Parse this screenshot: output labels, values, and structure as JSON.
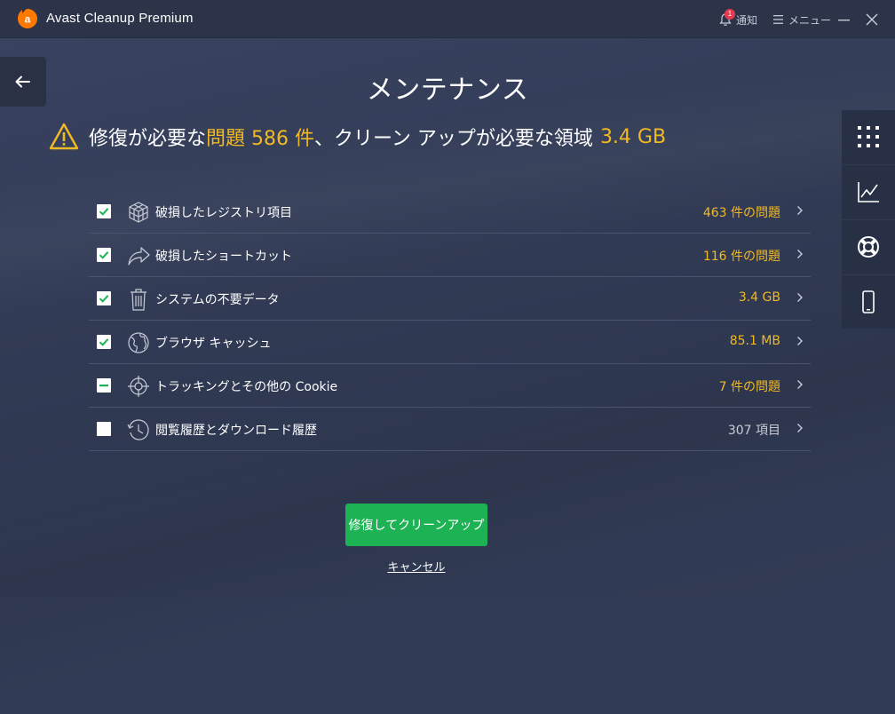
{
  "window": {
    "app_title": "Avast Cleanup Premium",
    "notifications_label": "通知",
    "notifications_count": "1",
    "menu_label": "メニュー"
  },
  "page": {
    "title": "メンテナンス",
    "summary_prefix": "修復が必要な",
    "summary_problems_word": "問題",
    "summary_problems_count": "586 件",
    "summary_middle": "、クリーン アップが必要な領域",
    "summary_space": "3.4 GB"
  },
  "items": [
    {
      "label": "破損したレジストリ項目",
      "value": "463 件の問題",
      "state": "checked",
      "icon": "registry-cube-icon",
      "highlight": true
    },
    {
      "label": "破損したショートカット",
      "value": "116 件の問題",
      "state": "checked",
      "icon": "shortcut-arrow-icon",
      "highlight": true
    },
    {
      "label": "システムの不要データ",
      "value": "3.4 GB",
      "state": "checked",
      "icon": "trash-icon",
      "highlight": true
    },
    {
      "label": "ブラウザ キャッシュ",
      "value": "85.1 MB",
      "state": "checked",
      "icon": "globe-icon",
      "highlight": true
    },
    {
      "label": "トラッキングとその他の Cookie",
      "value": "7 件の問題",
      "state": "indeterminate",
      "icon": "crosshair-icon",
      "highlight": true
    },
    {
      "label": "閲覧履歴とダウンロード履歴",
      "value": "307 項目",
      "state": "unchecked",
      "icon": "history-clock-icon",
      "highlight": false
    }
  ],
  "side_tools": [
    "grid-icon",
    "chart-icon",
    "lifebuoy-icon",
    "phone-icon"
  ],
  "actions": {
    "fix_button": "修復してクリーンアップ",
    "cancel_link": "キャンセル"
  },
  "colors": {
    "background": "#323b55",
    "accent_yellow": "#f1b924",
    "primary_green": "#1db254",
    "check_green": "#1db254",
    "brand_orange": "#ff7800"
  }
}
